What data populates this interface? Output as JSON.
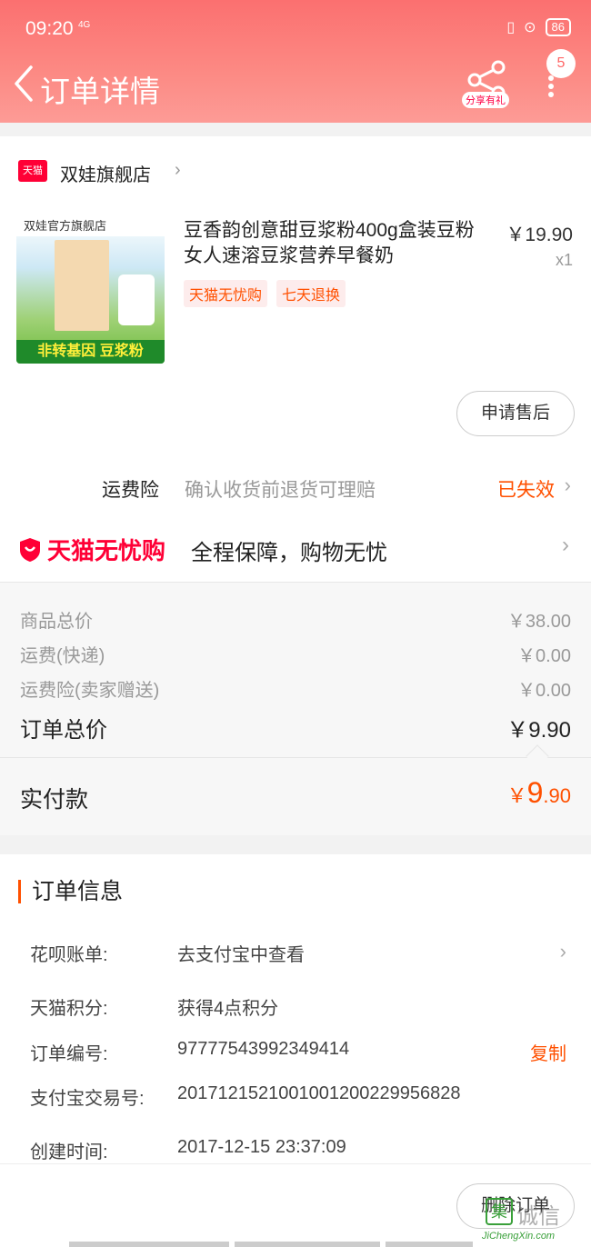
{
  "status_bar": {
    "time": "09:20",
    "signal": "4G",
    "battery": "86"
  },
  "header": {
    "title": "订单详情",
    "share_label": "分享有礼",
    "badge_count": "5"
  },
  "shop": {
    "icon_text": "天猫",
    "name": "双娃旗舰店"
  },
  "product": {
    "image_header": "双娃官方旗舰店",
    "image_footer": "非转基因  豆浆粉",
    "title": "豆香韵创意甜豆浆粉400g盒装豆粉女人速溶豆浆营养早餐奶",
    "price": "￥19.90",
    "qty": "x1",
    "tags": [
      "天猫无忧购",
      "七天退换"
    ],
    "aftersale_label": "申请售后"
  },
  "insurance": {
    "label": "运费险",
    "desc": "确认收货前退货可理赔",
    "status": "已失效"
  },
  "worry_free": {
    "logo_text": "天猫无忧购",
    "desc": "全程保障，购物无忧"
  },
  "summary": {
    "rows": [
      {
        "label": "商品总价",
        "value": "￥38.00"
      },
      {
        "label": "运费(快递)",
        "value": "￥0.00"
      },
      {
        "label": "运费险(卖家赠送)",
        "value": "￥0.00"
      }
    ],
    "total_label": "订单总价",
    "total_value": "￥9.90",
    "paid_label": "实付款",
    "paid_currency": "￥",
    "paid_int": "9",
    "paid_dec": ".90"
  },
  "order_info": {
    "title": "订单信息",
    "rows": [
      {
        "label": "花呗账单:",
        "value": "去支付宝中查看"
      },
      {
        "label": "天猫积分:",
        "value": "获得4点积分"
      },
      {
        "label": "订单编号:",
        "value": "97777543992349414",
        "action": "复制"
      },
      {
        "label": "支付宝交易号:",
        "value": "2017121521001001200229956828"
      },
      {
        "label": "创建时间:",
        "value": "2017-12-15 23:37:09"
      }
    ]
  },
  "bottom": {
    "delete_label": "删除订单"
  },
  "watermark": {
    "mark": "集",
    "text": "诚信",
    "sub": "JiChengXin.com"
  }
}
